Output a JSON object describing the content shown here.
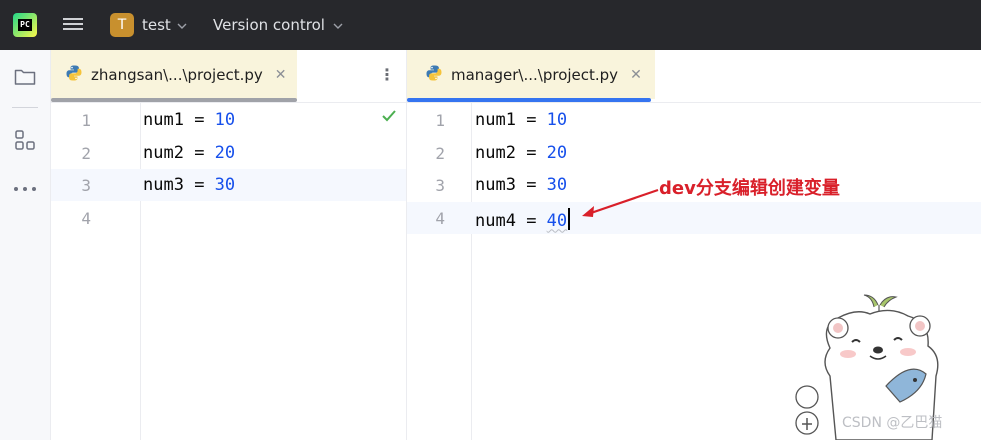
{
  "titlebar": {
    "logo_text": "PC",
    "project_initial": "T",
    "project_name": "test",
    "vcs_label": "Version control"
  },
  "left_pane": {
    "tab_label": "zhangsan\\...\\project.py",
    "tab_close": "✕",
    "more_icon": "⋮",
    "lines": [
      {
        "n": "1",
        "name": "num1",
        "op": " = ",
        "value": "10"
      },
      {
        "n": "2",
        "name": "num2",
        "op": " = ",
        "value": "20"
      },
      {
        "n": "3",
        "name": "num3",
        "op": " = ",
        "value": "30"
      },
      {
        "n": "4",
        "name": "",
        "op": "",
        "value": ""
      }
    ]
  },
  "right_pane": {
    "tab_label": "manager\\...\\project.py",
    "tab_close": "✕",
    "lines": [
      {
        "n": "1",
        "name": "num1",
        "op": " = ",
        "value": "10"
      },
      {
        "n": "2",
        "name": "num2",
        "op": " = ",
        "value": "20"
      },
      {
        "n": "3",
        "name": "num3",
        "op": " = ",
        "value": "30"
      },
      {
        "n": "4",
        "name": "num4",
        "op": " = ",
        "value": "40"
      }
    ]
  },
  "annotation": {
    "text": "dev分支编辑创建变量"
  },
  "watermark": {
    "text": "CSDN @乙巴猫"
  },
  "colors": {
    "titlebar_bg": "#27282c",
    "tab_bg": "#f9f4dc",
    "left_tab_underline": "#a0a2a8",
    "right_tab_underline": "#3574f0",
    "number_color": "#1750eb",
    "annotation_color": "#d9202a",
    "check_color": "#4caf50"
  },
  "icons": {
    "sidebar": [
      "folder-icon",
      "structure-icon",
      "more-horizontal-icon"
    ],
    "tabs": [
      "python-file-icon"
    ],
    "status": "checkmark-icon"
  }
}
